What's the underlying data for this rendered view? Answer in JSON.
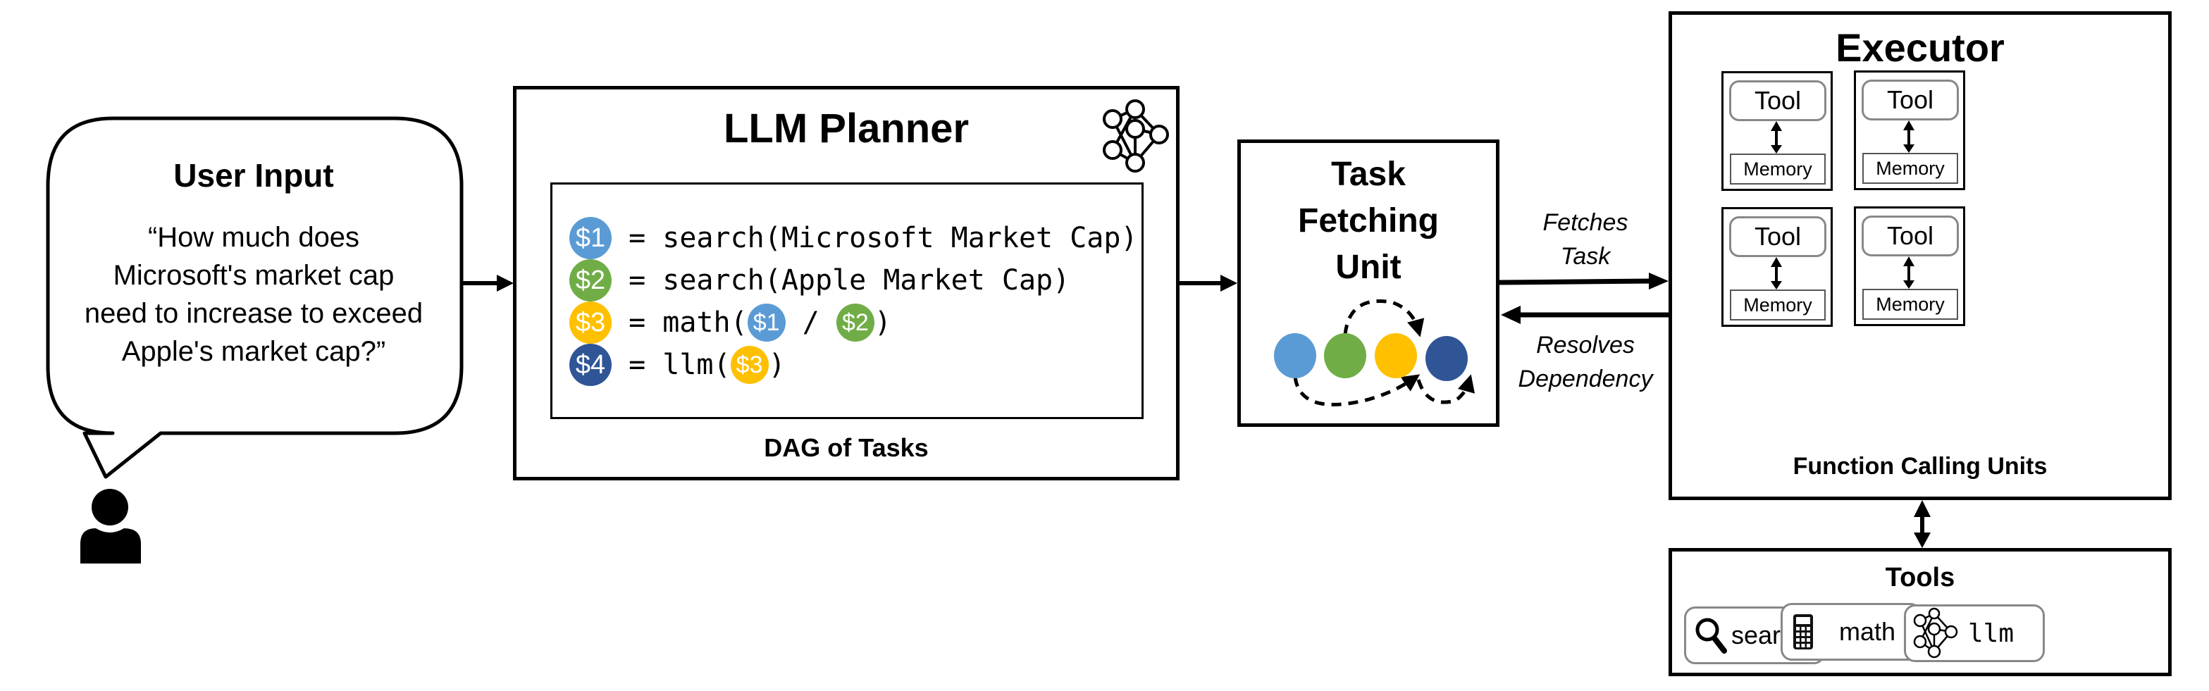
{
  "user_input": {
    "title": "User Input",
    "query_lines": [
      "“How much does",
      "Microsoft's market cap",
      "need to increase to exceed",
      "Apple's market cap?”"
    ],
    "icon": "user-icon"
  },
  "planner": {
    "title": "LLM Planner",
    "icon": "neural-network-icon",
    "dag": {
      "caption": "DAG of Tasks",
      "lines": [
        {
          "var": "$1",
          "color": "#5b9bd5",
          "prefix": " = search(Microsoft Market Cap)",
          "args": []
        },
        {
          "var": "$2",
          "color": "#70ad47",
          "prefix": " = search(Apple Market Cap)",
          "args": []
        },
        {
          "var": "$3",
          "color": "#ffc000",
          "prefix": " = math(",
          "args": [
            {
              "var": "$1",
              "color": "#5b9bd5"
            },
            {
              "sep": " / "
            },
            {
              "var": "$2",
              "color": "#70ad47"
            }
          ],
          "suffix": ")"
        },
        {
          "var": "$4",
          "color": "#2f5597",
          "prefix": " = llm(",
          "args": [
            {
              "var": "$3",
              "color": "#ffc000"
            }
          ],
          "suffix": ")"
        }
      ]
    }
  },
  "task_fetching_unit": {
    "title_lines": [
      "Task",
      "Fetching",
      "Unit"
    ],
    "nodes": [
      {
        "id": "$1",
        "color": "#5b9bd5"
      },
      {
        "id": "$2",
        "color": "#70ad47"
      },
      {
        "id": "$3",
        "color": "#ffc000"
      },
      {
        "id": "$4",
        "color": "#2f5597"
      }
    ],
    "dependencies": [
      [
        "$1",
        "$3"
      ],
      [
        "$2",
        "$3"
      ],
      [
        "$3",
        "$4"
      ]
    ]
  },
  "edges": {
    "fetches_label": [
      "Fetches",
      "Task"
    ],
    "resolves_label": [
      "Resolves",
      "Dependency"
    ]
  },
  "executor": {
    "title": "Executor",
    "caption": "Function Calling Units",
    "units": [
      {
        "tool": "Tool",
        "memory": "Memory"
      },
      {
        "tool": "Tool",
        "memory": "Memory"
      },
      {
        "tool": "Tool",
        "memory": "Memory"
      },
      {
        "tool": "Tool",
        "memory": "Memory"
      }
    ]
  },
  "tools": {
    "title": "Tools",
    "items": [
      {
        "label": "search",
        "icon": "search-icon"
      },
      {
        "label": "math",
        "icon": "calculator-icon"
      },
      {
        "label": "llm",
        "icon": "neural-network-icon"
      }
    ],
    "ellipsis": "..."
  }
}
